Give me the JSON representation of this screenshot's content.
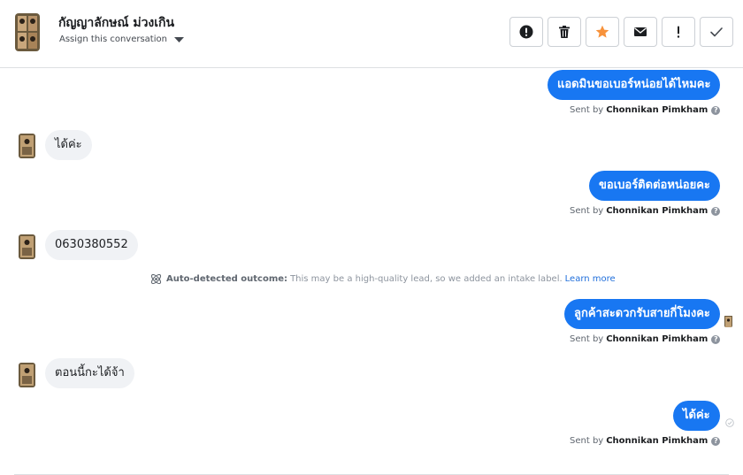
{
  "header": {
    "contact_name": "กัญญาลักษณ์ ม่วงเกิน",
    "assign_label": "Assign this conversation",
    "actions": [
      {
        "icon": "alert-circle-icon",
        "label": "Mark as spam"
      },
      {
        "icon": "trash-icon",
        "label": "Delete"
      },
      {
        "icon": "star-icon",
        "label": "Star"
      },
      {
        "icon": "envelope-icon",
        "label": "Mark as unread"
      },
      {
        "icon": "exclamation-icon",
        "label": "Follow up"
      },
      {
        "icon": "check-icon",
        "label": "Mark as done"
      }
    ]
  },
  "messages": [
    {
      "direction": "out",
      "text": "แอดมินขอเบอร์หน่อยได้ไหมคะ",
      "sent_prefix": "Sent by",
      "sender": "Chonnikan Pimkham"
    },
    {
      "direction": "in",
      "text": "ได้ค่ะ"
    },
    {
      "direction": "out",
      "text": "ขอเบอร์ติดต่อหน่อยคะ",
      "sent_prefix": "Sent by",
      "sender": "Chonnikan Pimkham"
    },
    {
      "direction": "in",
      "text": "0630380552"
    },
    {
      "direction": "out",
      "text": "ลูกค้าสะดวกรับสายกี่โมงคะ",
      "sent_prefix": "Sent by",
      "sender": "Chonnikan Pimkham"
    },
    {
      "direction": "in",
      "text": "ตอนนี้กะได้จ้า"
    },
    {
      "direction": "out",
      "text": "ได้ค่ะ",
      "sent_prefix": "Sent by",
      "sender": "Chonnikan Pimkham"
    }
  ],
  "auto_outcome": {
    "label": "Auto-detected outcome:",
    "text": "This may be a high-quality lead, so we added an intake label.",
    "link": "Learn more"
  },
  "help_glyph": "?",
  "colors": {
    "accent": "#1877f2",
    "incoming_bubble": "#f0f2f5",
    "star": "#f7923b",
    "link": "#216fdb"
  }
}
